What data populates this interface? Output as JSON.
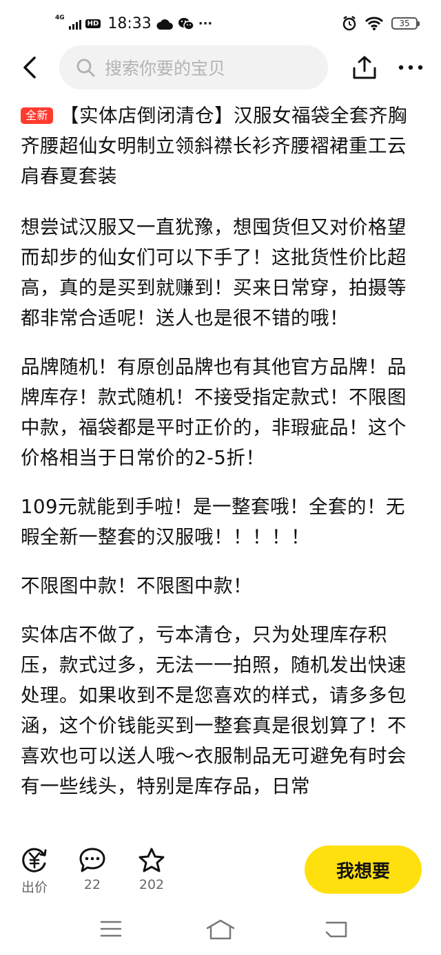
{
  "status_bar": {
    "network": "4G",
    "hd": "HD",
    "time": "18:33",
    "more": "···",
    "battery": "35"
  },
  "header": {
    "search_placeholder": "搜索你要的宝贝"
  },
  "product": {
    "badge": "全新",
    "title": "【实体店倒闭清仓】汉服女福袋全套齐胸齐腰超仙女明制立领斜襟长衫齐腰褶裙重工云肩春夏套装",
    "paragraphs": [
      "想尝试汉服又一直犹豫，想囤货但又对价格望而却步的仙女们可以下手了！这批货性价比超高，真的是买到就赚到！买来日常穿，拍摄等都非常合适呢！送人也是很不错的哦！",
      "品牌随机！有原创品牌也有其他官方品牌！品牌库存！款式随机！不接受指定款式！不限图中款，福袋都是平时正价的，非瑕疵品！这个价格相当于日常价的2-5折！",
      "109元就能到手啦！是一整套哦！全套的！无暇全新一整套的汉服哦！！！！！",
      "不限图中款！不限图中款！",
      "实体店不做了，亏本清仓，只为处理库存积压，款式过多，无法一一拍照，随机发出快速处理。如果收到不是您喜欢的样式，请多多包涵，这个价钱能买到一整套真是很划算了！不喜欢也可以送人哦～衣服制品无可避免有时会有一些线头，特别是库存品，日常"
    ]
  },
  "action_bar": {
    "offer_label": "出价",
    "comments_count": "22",
    "favorites_count": "202",
    "want_button": "我想要"
  },
  "colors": {
    "accent_yellow": "#ffe00f",
    "badge_red": "#ff3b2f"
  }
}
